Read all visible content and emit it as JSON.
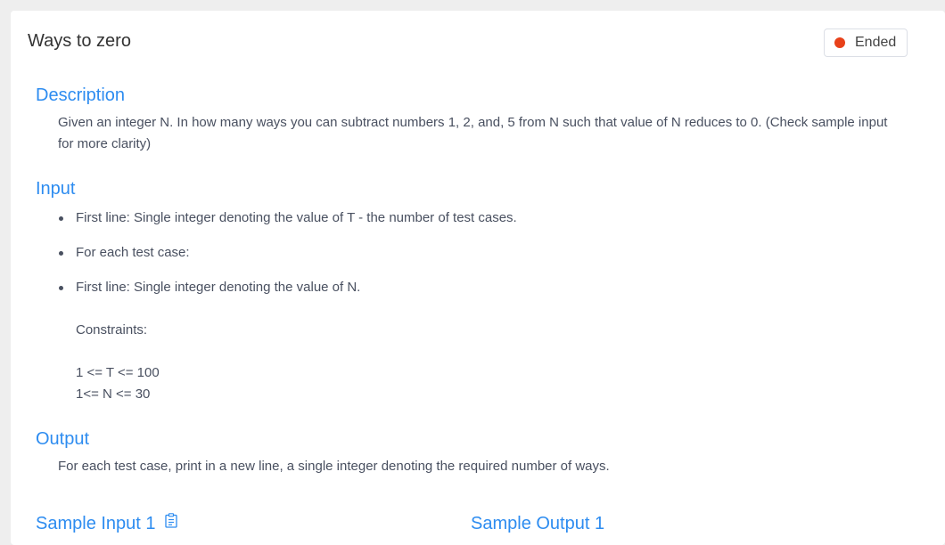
{
  "problem": {
    "title": "Ways to zero",
    "status": "Ended",
    "status_color": "#e8411a",
    "accent_color": "#2d8cf0"
  },
  "description": {
    "heading": "Description",
    "text": "Given an integer N. In how many ways you can subtract numbers 1, 2, and, 5 from N such that value of N reduces to 0. (Check sample input for more clarity)"
  },
  "input": {
    "heading": "Input",
    "bullets": [
      "First line: Single integer denoting the value of T - the number of test cases.",
      "For each test case:",
      "First line: Single integer denoting the value of N."
    ],
    "constraints_label": "Constraints:",
    "constraint_lines": [
      "1 <= T <= 100",
      "1<= N <= 30"
    ]
  },
  "output": {
    "heading": "Output",
    "text": "For each test case, print in a new line, a single integer denoting the required number of ways."
  },
  "samples": {
    "input_heading": "Sample Input 1",
    "output_heading": "Sample Output 1",
    "copy_icon": "clipboard-icon"
  }
}
